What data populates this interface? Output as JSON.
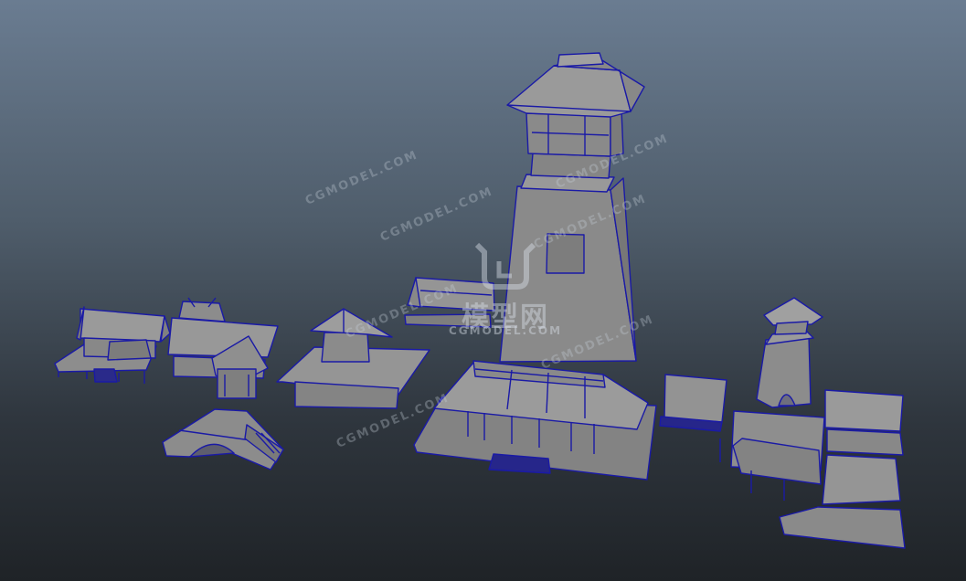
{
  "viewport": {
    "background_top": "#6a7c91",
    "background_bottom": "#1f2327",
    "wireframe_color": "#1a1aa6",
    "face_color": "#8e8e8e"
  },
  "watermark": {
    "brand_cn": "模型网",
    "brand_en": "CGMODEL.COM",
    "repeated_text": [
      "CGMODEL.COM",
      "CGMODEL.COM",
      "CGMODEL.COM",
      "CGMODEL.COM",
      "CGMODEL.COM",
      "CGMODEL.COM",
      "CGMODEL.COM"
    ]
  },
  "models": [
    "stilt-house",
    "shrine-house",
    "arch-bridge",
    "pagoda-house",
    "small-shed",
    "watch-tower",
    "main-hall",
    "small-box-house",
    "round-lookout-tower",
    "courtyard-complex"
  ]
}
